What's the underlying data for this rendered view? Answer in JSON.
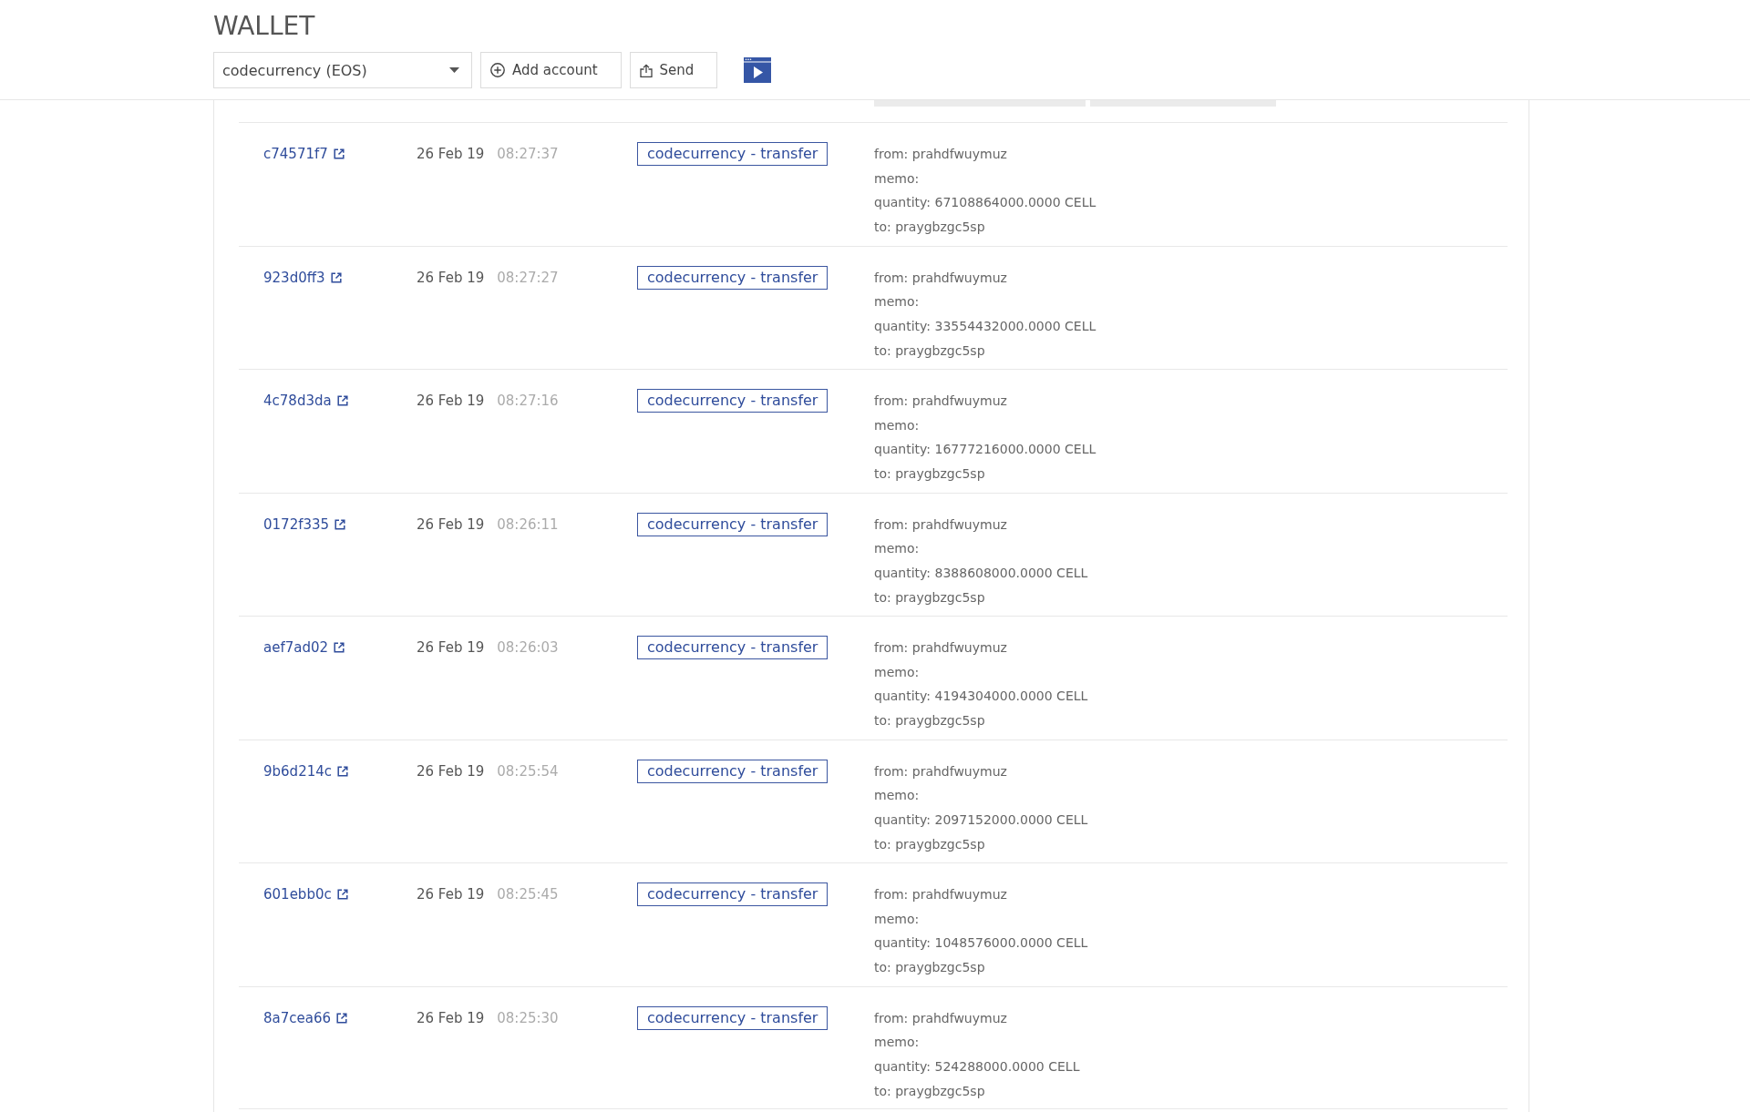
{
  "header": {
    "title": "WALLET",
    "account_select": {
      "value": "codecurrency (EOS)"
    },
    "actions": [
      {
        "kind": "add",
        "label": "Add account"
      },
      {
        "kind": "send",
        "label": "Send"
      }
    ]
  },
  "transactions": [
    {
      "id": "c74571f7",
      "date": "26 Feb 19",
      "time": "08:27:37",
      "action": "codecurrency - transfer",
      "details": [
        "from: prahdfwuymuz",
        "memo:",
        "quantity: 67108864000.0000 CELL",
        "to: praygbzgc5sp"
      ]
    },
    {
      "id": "923d0ff3",
      "date": "26 Feb 19",
      "time": "08:27:27",
      "action": "codecurrency - transfer",
      "details": [
        "from: prahdfwuymuz",
        "memo:",
        "quantity: 33554432000.0000 CELL",
        "to: praygbzgc5sp"
      ]
    },
    {
      "id": "4c78d3da",
      "date": "26 Feb 19",
      "time": "08:27:16",
      "action": "codecurrency - transfer",
      "details": [
        "from: prahdfwuymuz",
        "memo:",
        "quantity: 16777216000.0000 CELL",
        "to: praygbzgc5sp"
      ]
    },
    {
      "id": "0172f335",
      "date": "26 Feb 19",
      "time": "08:26:11",
      "action": "codecurrency - transfer",
      "details": [
        "from: prahdfwuymuz",
        "memo:",
        "quantity: 8388608000.0000 CELL",
        "to: praygbzgc5sp"
      ]
    },
    {
      "id": "aef7ad02",
      "date": "26 Feb 19",
      "time": "08:26:03",
      "action": "codecurrency - transfer",
      "details": [
        "from: prahdfwuymuz",
        "memo:",
        "quantity: 4194304000.0000 CELL",
        "to: praygbzgc5sp"
      ]
    },
    {
      "id": "9b6d214c",
      "date": "26 Feb 19",
      "time": "08:25:54",
      "action": "codecurrency - transfer",
      "details": [
        "from: prahdfwuymuz",
        "memo:",
        "quantity: 2097152000.0000 CELL",
        "to: praygbzgc5sp"
      ]
    },
    {
      "id": "601ebb0c",
      "date": "26 Feb 19",
      "time": "08:25:45",
      "action": "codecurrency - transfer",
      "details": [
        "from: prahdfwuymuz",
        "memo:",
        "quantity: 1048576000.0000 CELL",
        "to: praygbzgc5sp"
      ]
    },
    {
      "id": "8a7cea66",
      "date": "26 Feb 19",
      "time": "08:25:30",
      "action": "codecurrency - transfer",
      "details": [
        "from: prahdfwuymuz",
        "memo:",
        "quantity: 524288000.0000 CELL",
        "to: praygbzgc5sp"
      ]
    }
  ]
}
